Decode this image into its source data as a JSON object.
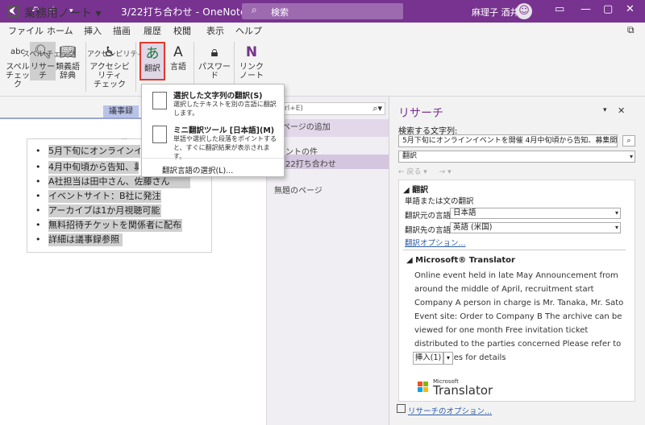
{
  "titlebar": {
    "title": "3/22打ち合わせ - OneNote",
    "search_placeholder": "検索",
    "user_name": "麻理子 酒井",
    "minimize": "—",
    "restore": "▢",
    "close": "✕"
  },
  "menu": {
    "tabs": [
      "ファイル",
      "ホーム",
      "挿入",
      "描画",
      "履歴",
      "校閲",
      "表示",
      "ヘルプ"
    ],
    "active": "校閲"
  },
  "ribbon": {
    "spell_check": "スペル\nチェック",
    "research": "リサーチ",
    "thesaurus": "類義語\n辞典",
    "accessibility": "アクセシビリティ\nチェック",
    "translate": "翻訳",
    "language": "言語",
    "password": "パスワード",
    "linked_notes": "リンク\nノート",
    "group_spell": "スペル チェック",
    "group_access": "アクセシビリティ",
    "spell_icon_text": "abc"
  },
  "notebook": {
    "title": "業務用ノート ▾",
    "section_tab": "議事録"
  },
  "note": {
    "lines": [
      "5月下旬にオンラインイベ",
      "4月中旬頃から告知、募",
      "A社担当は田中さん、佐藤さん",
      "イベントサイト：B社に発注",
      "アーカイブは1か月視聴可能",
      "無料招待チケットを関係者に配布",
      "詳細は議事録参照"
    ]
  },
  "pages": {
    "search_placeholder": "rl+E)",
    "add_page": "ページの追加",
    "item1": "ントの件",
    "item2": "22打ち合わせ",
    "item3": "無題のページ"
  },
  "research": {
    "title": "リサーチ",
    "search_label": "検索する文字列:",
    "search_value": "5月下旬にオンラインイベントを開催 4月中旬頃から告知、募集開始 A社担",
    "service": "翻訳",
    "nav_back": "← 戻る",
    "nav_forward": "→",
    "section": "翻訳",
    "subsection": "単語または文の翻訳",
    "from_label": "翻訳元の言語",
    "from_value": "日本語",
    "to_label": "翻訳先の言語",
    "to_value": "英語 (米国)",
    "options_link": "翻訳オプション...",
    "ms_header": "Microsoft® Translator",
    "ms_text": "Online event held in late May Announcement from around the middle of April, recruitment start Company A person in charge is Mr. Tanaka, Mr. Sato Event site: Order to Company B The archive can be viewed for one month Free invitation ticket distributed to the parties concerned Please refer to the minutes for details",
    "insert_button": "挿入(1)",
    "logo_small": "Microsoft",
    "logo_big": "Translator",
    "footer_link": "リサーチのオプション..."
  },
  "popup": {
    "item1_title": "選択した文字列の翻訳(S)",
    "item1_desc": "選択したテキストを別の言語に翻訳します。",
    "item2_title": "ミニ翻訳ツール [日本語](M)",
    "item2_desc": "単語や選択した段落をポイントすると、すぐに翻訳結果が表示されます。",
    "item3": "翻訳言語の選択(L)..."
  },
  "colors": {
    "accent": "#77338f",
    "highlight": "#e03a2e",
    "link": "#2e5ea8"
  }
}
